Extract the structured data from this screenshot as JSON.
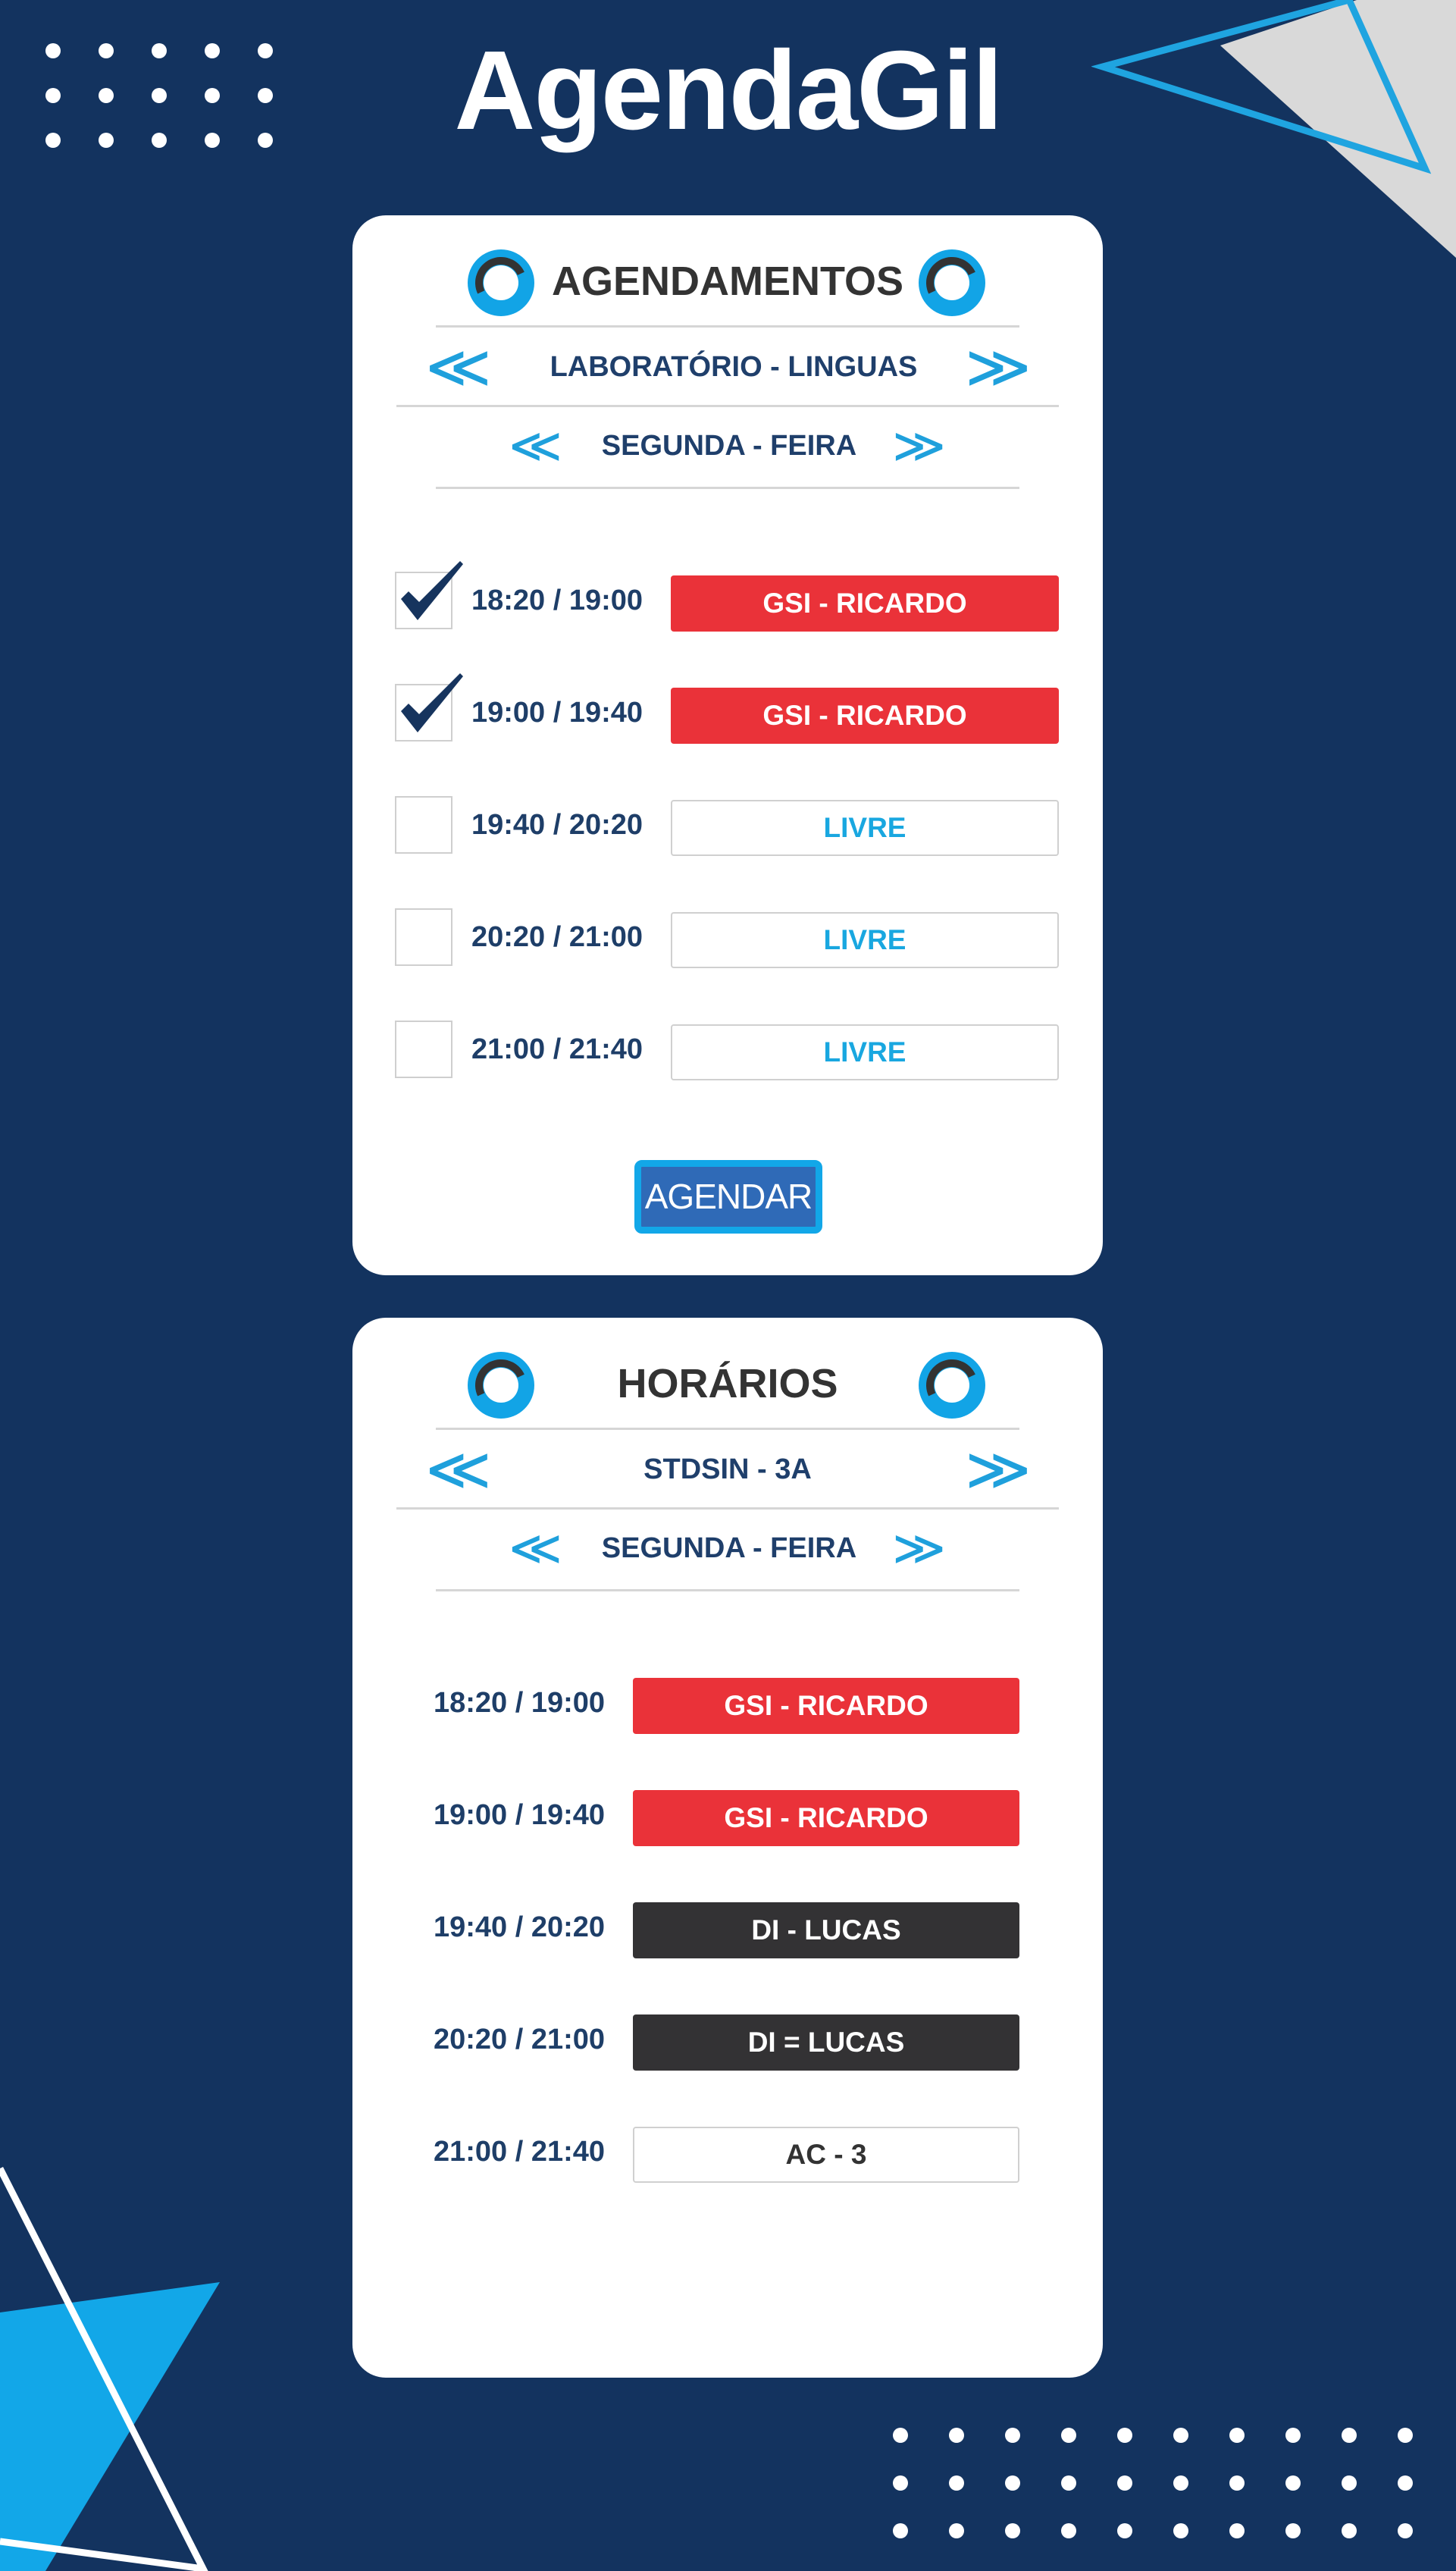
{
  "app": {
    "title": "AgendaGil"
  },
  "agendamentos": {
    "title": "AGENDAMENTOS",
    "room": "LABORATÓRIO - LINGUAS",
    "day": "SEGUNDA - FEIRA",
    "prev_symbol": "≪",
    "next_symbol": "≫",
    "slots": [
      {
        "time": "18:20 / 19:00",
        "status": "GSI - RICARDO",
        "checked": true
      },
      {
        "time": "19:00 / 19:40",
        "status": "GSI - RICARDO",
        "checked": true
      },
      {
        "time": "19:40 / 20:20",
        "status": "LIVRE",
        "checked": false
      },
      {
        "time": "20:20 / 21:00",
        "status": "LIVRE",
        "checked": false
      },
      {
        "time": "21:00 / 21:40",
        "status": "LIVRE",
        "checked": false
      }
    ],
    "button_label": "AGENDAR"
  },
  "horarios": {
    "title": "HORÁRIOS",
    "class": "STDSIN - 3A",
    "day": "SEGUNDA - FEIRA",
    "slots": [
      {
        "time": "18:20 / 19:00",
        "subject": "GSI - RICARDO"
      },
      {
        "time": "19:00 / 19:40",
        "subject": "GSI - RICARDO"
      },
      {
        "time": "19:40 / 20:20",
        "subject": "DI - LUCAS"
      },
      {
        "time": "20:20 / 21:00",
        "subject": "DI = LUCAS"
      },
      {
        "time": "21:00 / 21:40",
        "subject": "AC - 3"
      }
    ]
  },
  "colors": {
    "background": "#13335f",
    "accent": "#12a4e6",
    "busy": "#ea3239",
    "dark_slot": "#333234",
    "button": "#2f6ab7"
  },
  "icons": [
    "clock-icon",
    "chevron-left-icon",
    "chevron-right-icon",
    "checkmark-icon"
  ]
}
